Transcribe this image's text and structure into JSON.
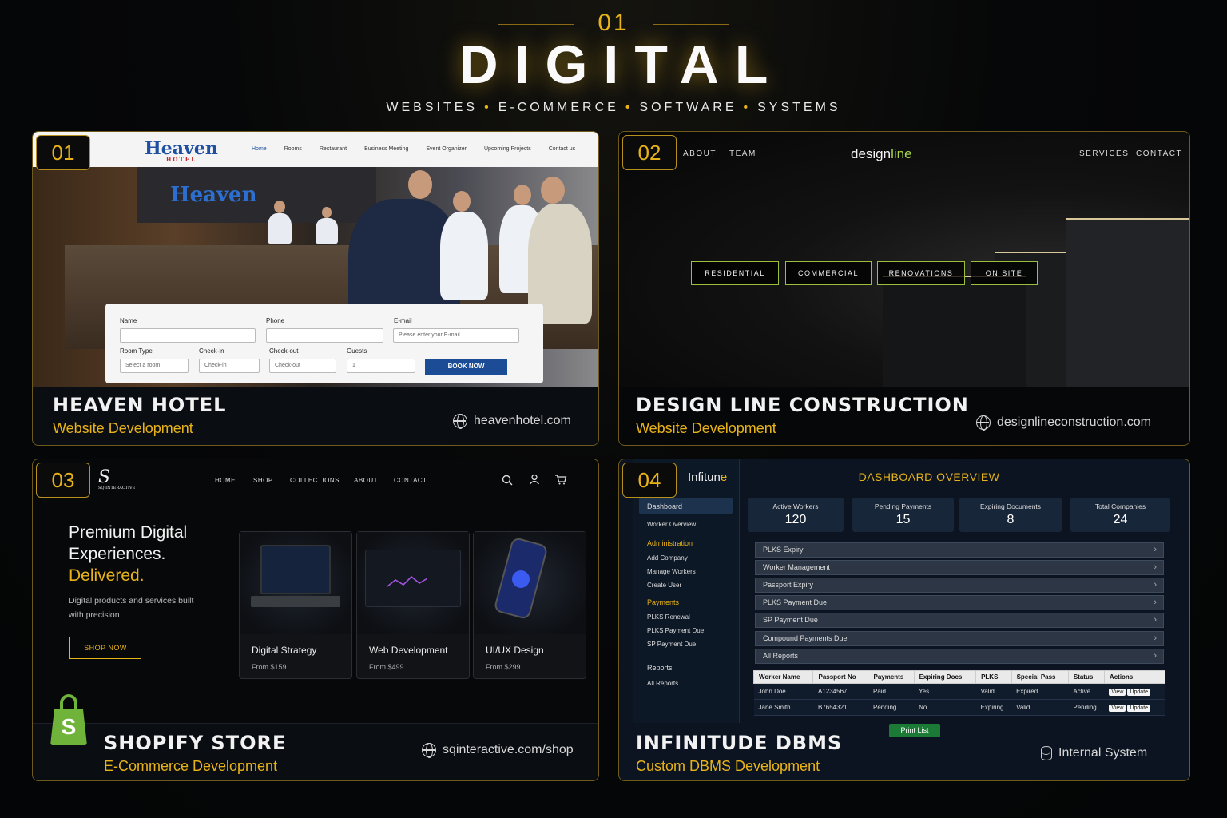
{
  "header": {
    "number": "01",
    "title": "DIGITAL",
    "subtitle": [
      "WEBSITES",
      "E-COMMERCE",
      "SOFTWARE",
      "SYSTEMS"
    ],
    "separator": "•"
  },
  "cards": [
    {
      "number": "01",
      "title": "HEAVEN HOTEL",
      "subtitle": "Website Development",
      "link": "heavenhotel.com",
      "site": {
        "logo": "Heaven",
        "logo_sub": "HOTEL",
        "wall_logo": "Heaven",
        "nav": [
          "Home",
          "Rooms",
          "Restaurant",
          "Business Meeting",
          "Event Organizer",
          "Upcoming Projects",
          "Contact us"
        ],
        "form": {
          "name_label": "Name",
          "phone_label": "Phone",
          "email_label": "E-mail",
          "email_placeholder": "Please enter your E-mail",
          "room_type_label": "Room Type",
          "room_type_value": "Select a room",
          "checkin_label": "Check-in",
          "checkin_value": "Check-in",
          "checkout_label": "Check-out",
          "checkout_value": "Check-out",
          "guests_label": "Guests",
          "guests_value": "1",
          "book_button": "BOOK NOW"
        }
      }
    },
    {
      "number": "02",
      "title": "DESIGN LINE CONSTRUCTION",
      "subtitle": "Website Development",
      "link": "designlineconstruction.com",
      "site": {
        "nav_left": [
          "ABOUT",
          "TEAM"
        ],
        "nav_right": [
          "SERVICES",
          "CONTACT"
        ],
        "logo_a": "design",
        "logo_b": "line",
        "tabs": [
          "RESIDENTIAL",
          "COMMERCIAL",
          "RENOVATIONS",
          "ON SITE"
        ]
      }
    },
    {
      "number": "03",
      "title": "SHOPIFY STORE",
      "subtitle": "E-Commerce Development",
      "link": "sqinteractive.com/shop",
      "site": {
        "logo": "S",
        "logo_sub": "SQ INTERACTIVE",
        "nav": [
          "HOME",
          "SHOP",
          "COLLECTIONS",
          "ABOUT",
          "CONTACT"
        ],
        "hero_1": "Premium Digital",
        "hero_2": "Experiences.",
        "hero_3": "Delivered.",
        "desc": "Digital products and services built with precision.",
        "shop_button": "SHOP NOW",
        "products": [
          {
            "name": "Digital Strategy",
            "price": "From $159"
          },
          {
            "name": "Web Development",
            "price": "From $499"
          },
          {
            "name": "UI/UX Design",
            "price": "From $299"
          }
        ]
      }
    },
    {
      "number": "04",
      "title": "INFINITUDE DBMS",
      "subtitle": "Custom DBMS Development",
      "link": "Internal System",
      "site": {
        "brand_a": "Infitun",
        "brand_b": "e",
        "dashboard_title": "DASHBOARD OVERVIEW",
        "sidebar": {
          "dashboard": "Dashboard",
          "worker_overview": "Worker Overview",
          "admin_heading": "Administration",
          "add_company": "Add Company",
          "manage_workers": "Manage Workers",
          "create_user": "Create User",
          "payments_heading": "Payments",
          "plks_renewal": "PLKS Renewal",
          "plks_payment_due": "PLKS Payment Due",
          "sp_payment_due": "SP Payment Due",
          "reports_heading": "Reports",
          "all_reports": "All Reports"
        },
        "stats": [
          {
            "label": "Active Workers",
            "value": "120"
          },
          {
            "label": "Pending Payments",
            "value": "15"
          },
          {
            "label": "Expiring Documents",
            "value": "8"
          },
          {
            "label": "Total Companies",
            "value": "24"
          }
        ],
        "menu": [
          "PLKS Expiry",
          "Worker Management",
          "Passport Expiry",
          "PLKS Payment Due",
          "SP Payment Due",
          "Compound Payments Due",
          "All Reports"
        ],
        "table_headers": [
          "Worker Name",
          "Passport No",
          "Payments",
          "Expiring Docs",
          "PLKS",
          "Special Pass",
          "Status",
          "Actions"
        ],
        "table_rows": [
          [
            "John Doe",
            "A1234567",
            "Paid",
            "Yes",
            "Valid",
            "Expired",
            "Active"
          ],
          [
            "Jane Smith",
            "B7654321",
            "Pending",
            "No",
            "Expiring",
            "Valid",
            "Pending"
          ]
        ],
        "view_label": "View",
        "update_label": "Update",
        "print_button": "Print List"
      }
    }
  ]
}
